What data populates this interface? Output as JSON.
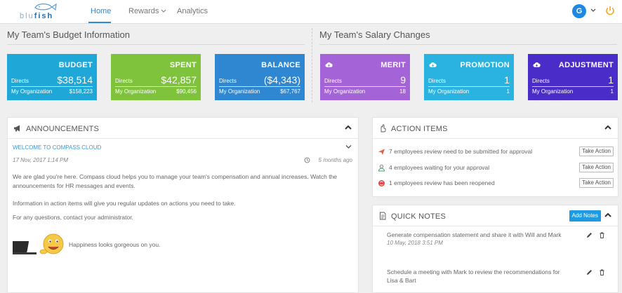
{
  "nav": {
    "logo_a": "blu",
    "logo_b": "fish",
    "items": [
      {
        "label": "Home",
        "active": true
      },
      {
        "label": "Rewards"
      },
      {
        "label": "Analytics"
      }
    ],
    "user_initial": "G",
    "power_color": "#f5a623"
  },
  "budget": {
    "title": "My Team's Budget Information",
    "cards": [
      {
        "title": "BUDGET",
        "lbl1": "Directs",
        "val1": "$38,514",
        "lbl2": "My Organization",
        "val2": "$158,223",
        "color": "#1fa7d8"
      },
      {
        "title": "SPENT",
        "lbl1": "Directs",
        "val1": "$42,857",
        "lbl2": "My Organization",
        "val2": "$90,456",
        "color": "#7fc23c"
      },
      {
        "title": "BALANCE",
        "lbl1": "Directs",
        "val1": "($4,343)",
        "lbl2": "My Organization",
        "val2": "$67,767",
        "color": "#2f86d1"
      }
    ]
  },
  "salary": {
    "title": "My Team's Salary Changes",
    "cards": [
      {
        "title": "MERIT",
        "lbl1": "Directs",
        "val1": "9",
        "lbl2": "My Organization",
        "val2": "18",
        "color": "#a463d6",
        "icon": "cloud-download-icon"
      },
      {
        "title": "PROMOTION",
        "lbl1": "Directs",
        "val1": "1",
        "lbl2": "My Organization",
        "val2": "1",
        "color": "#2ab3e0",
        "icon": "cloud-download-icon"
      },
      {
        "title": "ADJUSTMENT",
        "lbl1": "Directs",
        "val1": "1",
        "lbl2": "My Organization",
        "val2": "1",
        "color": "#4a2cc9",
        "icon": "cloud-download-icon"
      }
    ]
  },
  "announcements": {
    "title": "ANNOUNCEMENTS",
    "item_title": "WELCOME TO COMPASS CLOUD",
    "date": "17 Nov, 2017 1:14 PM",
    "ago": "5 months ago",
    "para1": "We are glad you're here. Compass cloud helps you to manage your team's compensation and annual increases. Watch the announcements for HR messages and events.",
    "para2": "Information in action items will give you regular updates on actions you need to take.",
    "para3": "For any questions, contact your administrator.",
    "caption": "Happiness looks gorgeous on you."
  },
  "action_items": {
    "title": "ACTION ITEMS",
    "rows": [
      {
        "text": "7 employees review need to be submitted for approval",
        "button": "Take Action",
        "icon": "send-icon",
        "color": "#e0604a"
      },
      {
        "text": "4 employees waiting for your approval",
        "button": "Take Action",
        "icon": "user-icon",
        "color": "#3aa86a"
      },
      {
        "text": "1 employees review has been reopened",
        "button": "Take Action",
        "icon": "reopen-icon",
        "color": "#e04848"
      }
    ]
  },
  "quick_notes": {
    "title": "QUICK NOTES",
    "add_label": "Add Notes",
    "notes": [
      {
        "text": "Generate compensation statement and share it with Will and Mark",
        "date": "10 May, 2018 3:51 PM"
      },
      {
        "text": "Schedule a meeting with Mark to review the recommendations for Lisa & Bart",
        "date": ""
      }
    ]
  }
}
